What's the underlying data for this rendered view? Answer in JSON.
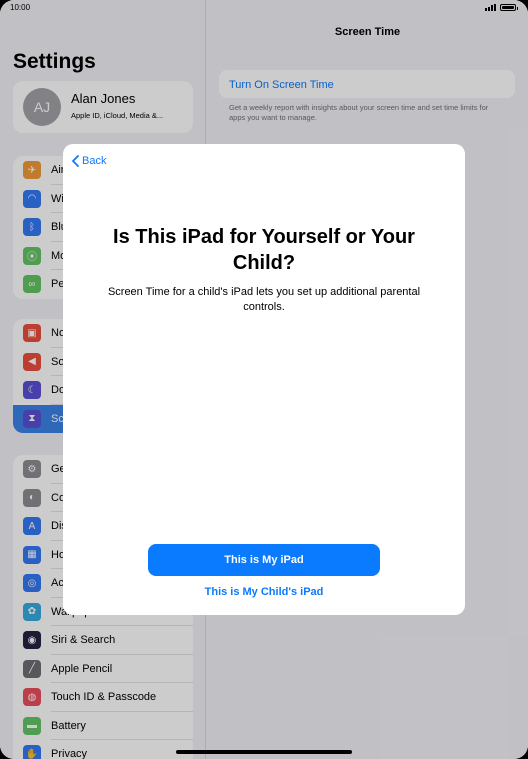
{
  "status": {
    "time": "10:00"
  },
  "sidebar": {
    "title": "Settings",
    "profile": {
      "initials": "AJ",
      "name": "Alan Jones",
      "subtitle": "Apple ID, iCloud, Media &..."
    },
    "group1": [
      {
        "label": "Air",
        "icon": "airplane-icon",
        "color": "#f09a37"
      },
      {
        "label": "Wi",
        "icon": "wifi-icon",
        "color": "#3478f6"
      },
      {
        "label": "Blu",
        "icon": "bluetooth-icon",
        "color": "#3478f6"
      },
      {
        "label": "Mo",
        "icon": "cellular-icon",
        "color": "#65c466"
      },
      {
        "label": "Pe",
        "icon": "hotspot-icon",
        "color": "#65c466"
      }
    ],
    "group2": [
      {
        "label": "No",
        "icon": "notifications-icon",
        "color": "#eb4e3d"
      },
      {
        "label": "So",
        "icon": "sounds-icon",
        "color": "#eb4e3d"
      },
      {
        "label": "Do",
        "icon": "moon-icon",
        "color": "#5b4fd6"
      },
      {
        "label": "Sc",
        "icon": "hourglass-icon",
        "color": "#5b4fd6",
        "selected": true
      }
    ],
    "group3": [
      {
        "label": "Ge",
        "icon": "gear-icon",
        "color": "#8e8e93"
      },
      {
        "label": "Co",
        "icon": "control-centre-icon",
        "color": "#8e8e93"
      },
      {
        "label": "Dis",
        "icon": "display-icon",
        "color": "#3478f6"
      },
      {
        "label": "Ho",
        "icon": "home-screen-icon",
        "color": "#3478f6"
      },
      {
        "label": "Ac",
        "icon": "accessibility-icon",
        "color": "#3478f6"
      },
      {
        "label": "Wallpaper",
        "icon": "wallpaper-icon",
        "color": "#36aadc"
      },
      {
        "label": "Siri & Search",
        "icon": "siri-icon",
        "color": "#222244"
      },
      {
        "label": "Apple Pencil",
        "icon": "pencil-icon",
        "color": "#6e6e73"
      },
      {
        "label": "Touch ID & Passcode",
        "icon": "fingerprint-icon",
        "color": "#eb4e5d"
      },
      {
        "label": "Battery",
        "icon": "battery-icon",
        "color": "#65c466"
      },
      {
        "label": "Privacy",
        "icon": "hand-icon",
        "color": "#3478f6"
      }
    ]
  },
  "detail": {
    "title": "Screen Time",
    "turn_on": "Turn On Screen Time",
    "note": "Get a weekly report with insights about your screen time and set time limits for apps you want to manage."
  },
  "modal": {
    "back": "Back",
    "title": "Is This iPad for Yourself or Your Child?",
    "description": "Screen Time for a child's iPad lets you set up additional parental controls.",
    "primary": "This is My iPad",
    "secondary": "This is My Child's iPad"
  }
}
